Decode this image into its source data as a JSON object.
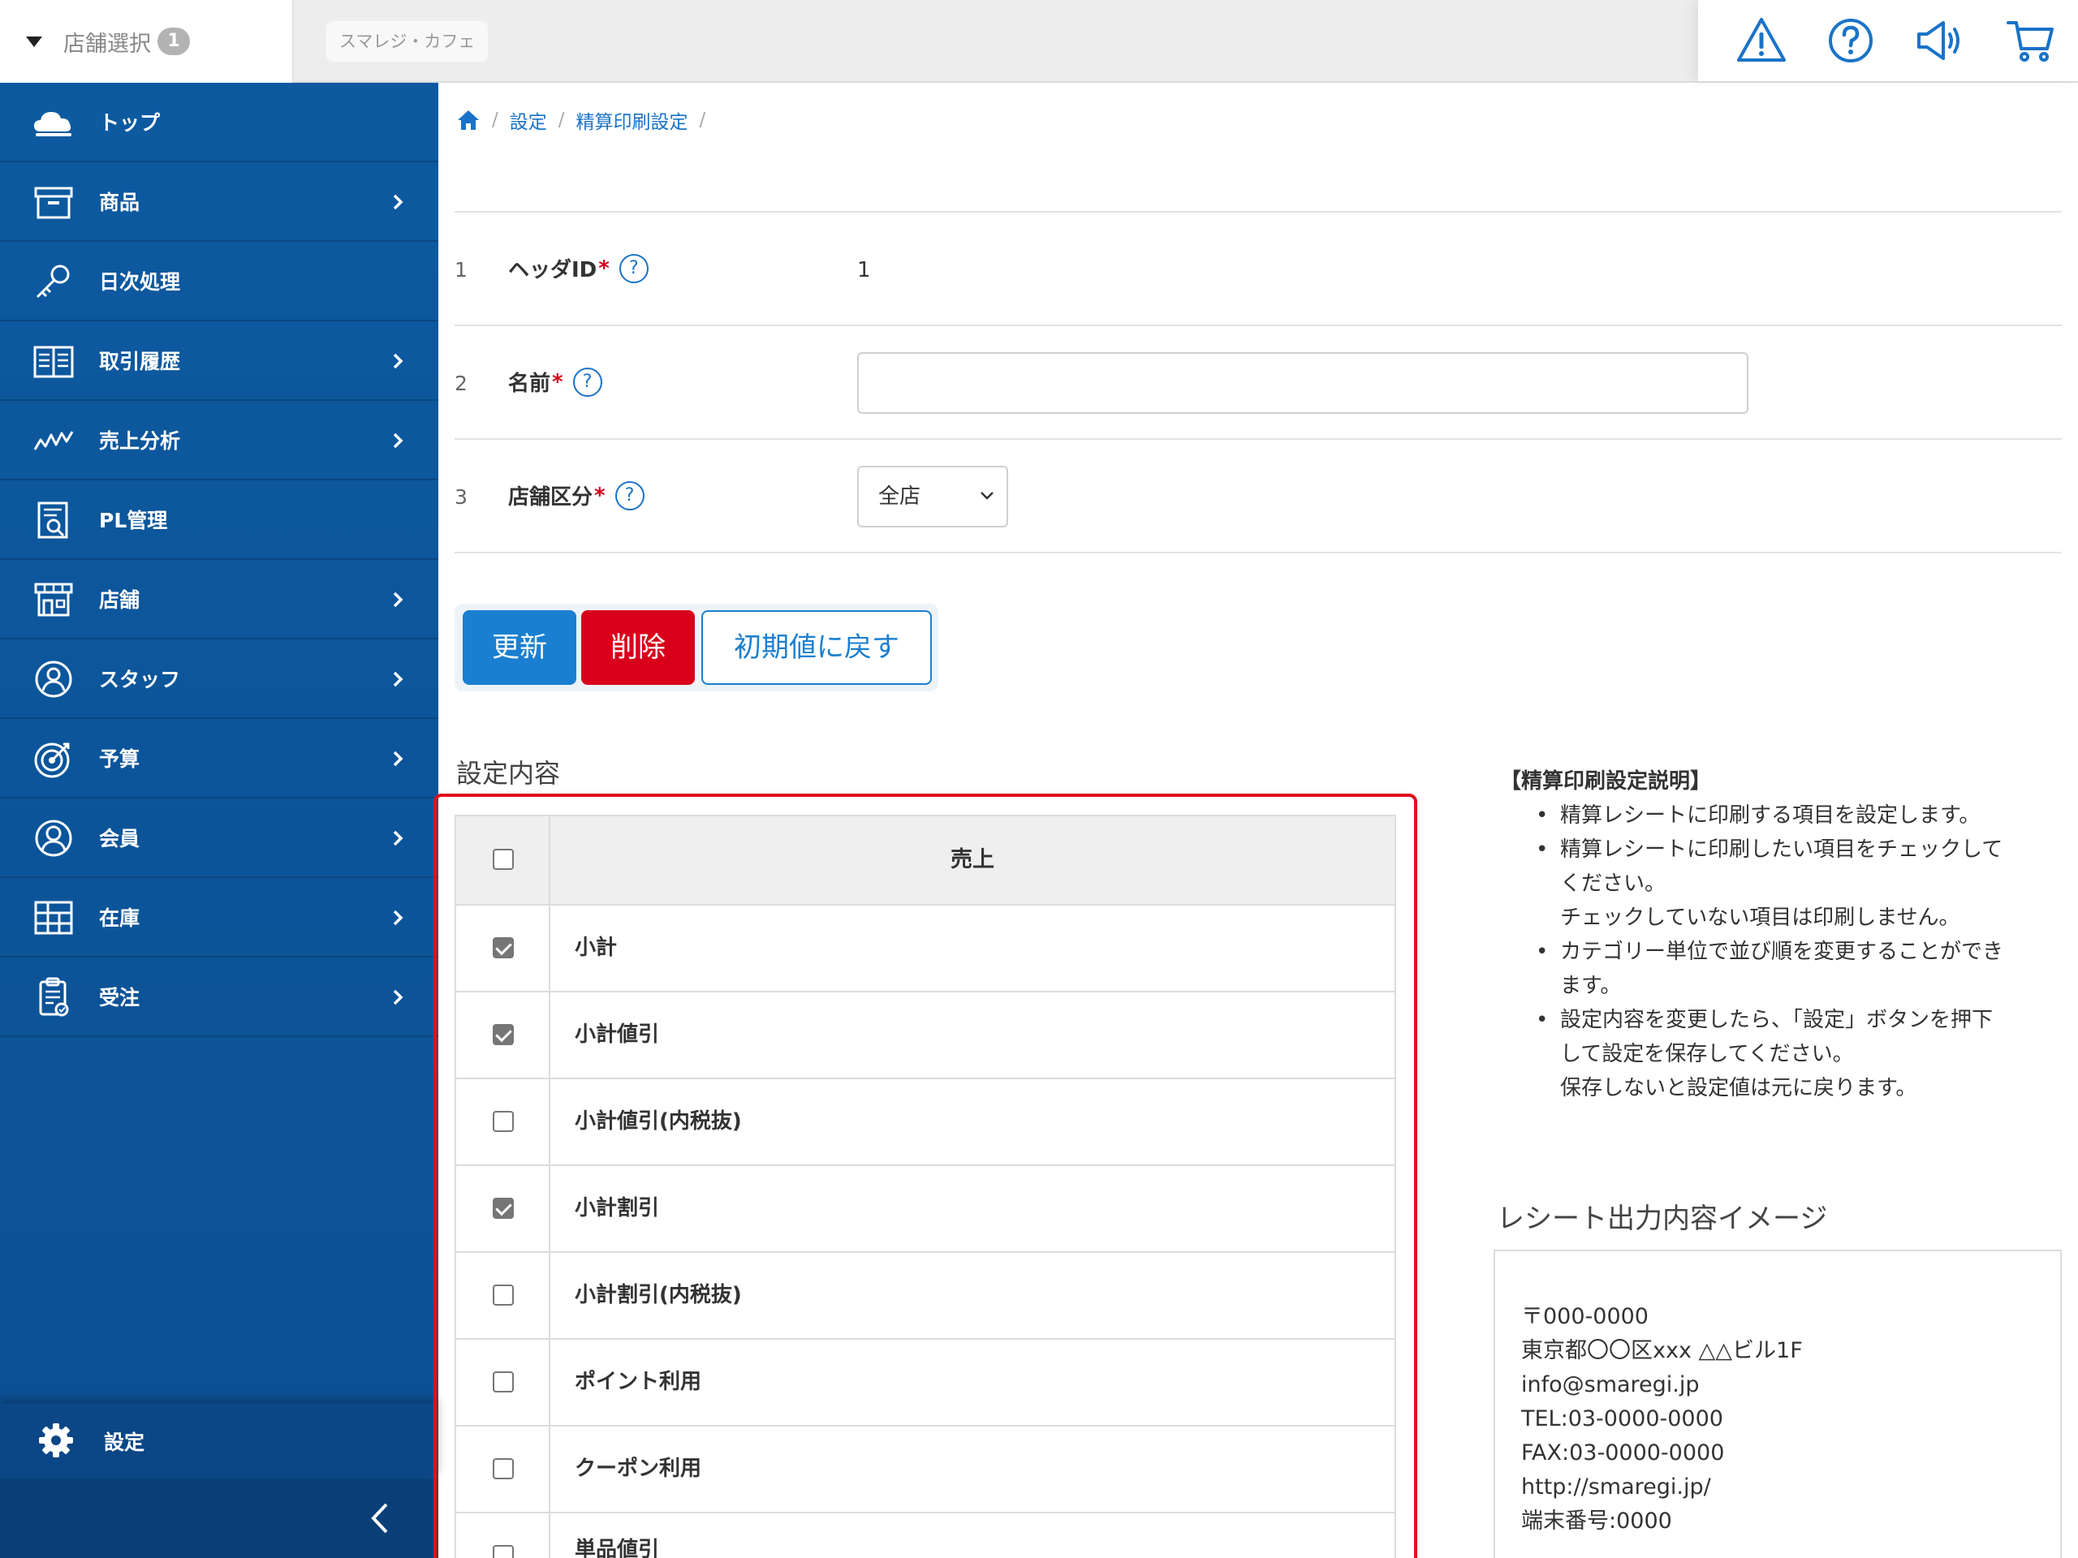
{
  "topbar": {
    "store_select_label": "店舗選択",
    "store_select_badge": "1",
    "shop_name": "スマレジ・カフェ",
    "icons": [
      "warning-icon",
      "help-icon",
      "megaphone-icon",
      "cart-icon"
    ],
    "accent": "#1a73c8"
  },
  "sidebar": {
    "items": [
      {
        "label": "トップ",
        "icon": "cloud-icon",
        "has_children": false
      },
      {
        "label": "商品",
        "icon": "box-icon",
        "has_children": true
      },
      {
        "label": "日次処理",
        "icon": "key-icon",
        "has_children": false
      },
      {
        "label": "取引履歴",
        "icon": "ledger-icon",
        "has_children": true
      },
      {
        "label": "売上分析",
        "icon": "chart-line-icon",
        "has_children": true
      },
      {
        "label": "PL管理",
        "icon": "report-icon",
        "has_children": false
      },
      {
        "label": "店舗",
        "icon": "store-icon",
        "has_children": true
      },
      {
        "label": "スタッフ",
        "icon": "staff-icon",
        "has_children": true
      },
      {
        "label": "予算",
        "icon": "target-icon",
        "has_children": true
      },
      {
        "label": "会員",
        "icon": "member-icon",
        "has_children": true
      },
      {
        "label": "在庫",
        "icon": "inventory-icon",
        "has_children": true
      },
      {
        "label": "受注",
        "icon": "clipboard-icon",
        "has_children": true
      }
    ],
    "settings_label": "設定",
    "background": "#0d5aa0"
  },
  "breadcrumb": {
    "items": [
      "設定",
      "精算印刷設定"
    ],
    "separator": "/"
  },
  "form": {
    "rows": [
      {
        "num": "1",
        "label": "ヘッダID",
        "required_mark": "*",
        "help": "?",
        "value": "1"
      },
      {
        "num": "2",
        "label": "名前",
        "required_mark": "*",
        "help": "?",
        "value": ""
      },
      {
        "num": "3",
        "label": "店舗区分",
        "required_mark": "*",
        "help": "?",
        "value": "全店"
      }
    ]
  },
  "buttons": {
    "update": "更新",
    "delete": "削除",
    "reset": "初期値に戻す",
    "update_color": "#1a7fd0",
    "delete_color": "#d9001b"
  },
  "settings_section": {
    "title": "設定内容",
    "table_header": "売上",
    "header_checked": false,
    "rows": [
      {
        "label": "小計",
        "checked": true
      },
      {
        "label": "小計値引",
        "checked": true
      },
      {
        "label": "小計値引(内税抜)",
        "checked": false
      },
      {
        "label": "小計割引",
        "checked": true
      },
      {
        "label": "小計割引(内税抜)",
        "checked": false
      },
      {
        "label": "ポイント利用",
        "checked": false
      },
      {
        "label": "クーポン利用",
        "checked": false
      },
      {
        "label": "単品値引",
        "checked": false
      }
    ],
    "highlight_color": "#e0101e"
  },
  "description": {
    "title": "【精算印刷設定説明】",
    "items": [
      [
        "精算レシートに印刷する項目を設定します。"
      ],
      [
        "精算レシートに印刷したい項目をチェックして",
        "ください。",
        "チェックしていない項目は印刷しません。"
      ],
      [
        "カテゴリー単位で並び順を変更することができ",
        "ます。"
      ],
      [
        "設定内容を変更したら、「設定」ボタンを押下",
        "して設定を保存してください。",
        "保存しないと設定値は元に戻ります。"
      ]
    ]
  },
  "receipt": {
    "title": "レシート出力内容イメージ",
    "lines": [
      "〒000-0000",
      "東京都〇〇区xxx △△ビル1F",
      "info@smaregi.jp",
      "TEL:03-0000-0000",
      "FAX:03-0000-0000",
      "http://smaregi.jp/",
      "端末番号:0000"
    ]
  }
}
